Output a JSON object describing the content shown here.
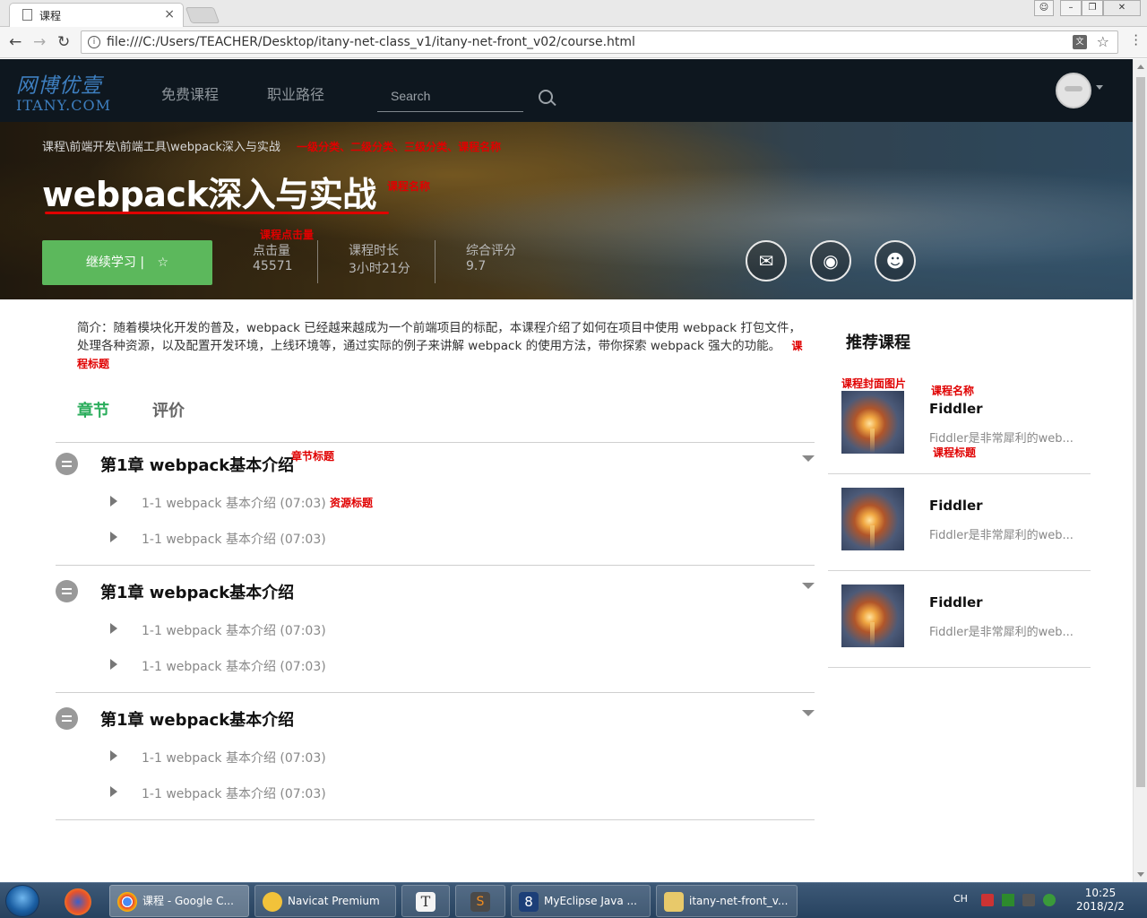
{
  "browser": {
    "tab_title": "课程",
    "tab_close": "×",
    "url": "file:///C:/Users/TEACHER/Desktop/itany-net-class_v1/itany-net-front_v02/course.html"
  },
  "header": {
    "logo_cn": "网博优壹",
    "logo_en": "ITANY.COM",
    "nav": [
      "免费课程",
      "职业路径"
    ],
    "search_placeholder": "Search"
  },
  "hero": {
    "breadcrumb": "课程\\前端开发\\前端工具\\webpack深入与实战",
    "breadcrumb_anno": "一级分类、二级分类、三级分类、课程名称",
    "title": "webpack深入与实战",
    "title_anno": "课程名称",
    "continue_label": "继续学习 |",
    "star": "☆",
    "clicks_anno": "课程点击量",
    "stats": [
      {
        "label": "点击量",
        "value": "45571"
      },
      {
        "label": "课程时长",
        "value": "3小时21分"
      },
      {
        "label": "综合评分",
        "value": "9.7"
      }
    ]
  },
  "intro": {
    "text": "简介：随着模块化开发的普及，webpack 已经越来越成为一个前端项目的标配，本课程介绍了如何在项目中使用 webpack 打包文件，处理各种资源，以及配置开发环境，上线环境等，通过实际的例子来讲解 webpack 的使用方法，带你探索 webpack 强大的功能。",
    "anno": "课程标题"
  },
  "tabs": {
    "chapters": "章节",
    "reviews": "评价"
  },
  "annotations": {
    "chapter_title": "章节标题",
    "resource_title": "资源标题"
  },
  "chapters": [
    {
      "title": "第1章 webpack基本介绍",
      "resources": [
        "1-1 webpack 基本介绍 (07:03)",
        "1-1 webpack 基本介绍 (07:03)"
      ]
    },
    {
      "title": "第1章 webpack基本介绍",
      "resources": [
        "1-1 webpack 基本介绍 (07:03)",
        "1-1 webpack 基本介绍 (07:03)"
      ]
    },
    {
      "title": "第1章 webpack基本介绍",
      "resources": [
        "1-1 webpack 基本介绍 (07:03)",
        "1-1 webpack 基本介绍 (07:03)"
      ]
    }
  ],
  "sidebar": {
    "title": "推荐课程",
    "anno_cover": "课程封面图片",
    "anno_name": "课程名称",
    "anno_desc": "课程标题",
    "courses": [
      {
        "name": "Fiddler",
        "desc": "Fiddler是非常犀利的web..."
      },
      {
        "name": "Fiddler",
        "desc": "Fiddler是非常犀利的web..."
      },
      {
        "name": "Fiddler",
        "desc": "Fiddler是非常犀利的web..."
      }
    ]
  },
  "taskbar": {
    "items": [
      "课程 - Google C...",
      "Navicat Premium",
      "",
      "",
      "MyEclipse Java ...",
      "itany-net-front_v..."
    ],
    "lang": "CH",
    "time": "10:25",
    "date": "2018/2/2"
  }
}
